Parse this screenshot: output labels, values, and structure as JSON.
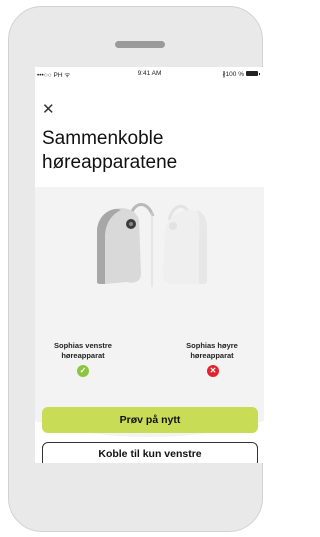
{
  "status_bar": {
    "carrier": "•••○○ PH ᯤ",
    "time": "9:41 AM",
    "battery": "∦100 %"
  },
  "page": {
    "title": "Sammenkoble høreapparatene"
  },
  "devices": {
    "left_label": "Sophias venstre høreapparat",
    "left_status": "success",
    "right_label": "Sophias høyre høreapparat",
    "right_status": "error"
  },
  "actions": {
    "retry_label": "Prøv på nytt",
    "left_only_label": "Koble til kun venstre"
  },
  "colors": {
    "accent": "#c8dc56",
    "success": "#8cc63f",
    "error": "#e0242e"
  }
}
